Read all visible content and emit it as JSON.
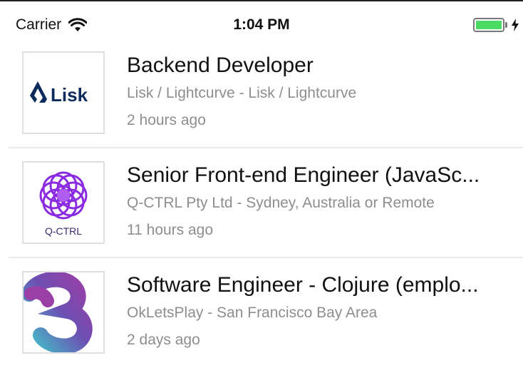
{
  "status_bar": {
    "carrier": "Carrier",
    "time": "1:04 PM",
    "battery_level": 1.0,
    "battery_color": "#4cd964"
  },
  "jobs": [
    {
      "title": "Backend Developer",
      "company": "Lisk / Lightcurve - Lisk / Lightcurve",
      "posted": "2 hours ago",
      "logo_text": "Lisk",
      "logo_icon": "lisk-logo-icon"
    },
    {
      "title": "Senior Front-end Engineer (JavaSc...",
      "company": "Q-CTRL Pty Ltd - Sydney, Australia or Remote",
      "posted": "11 hours ago",
      "logo_text": "Q-CTRL",
      "logo_icon": "qctrl-logo-icon"
    },
    {
      "title": "Software Engineer - Clojure (emplo...",
      "company": "OkLetsPlay - San Francisco Bay Area",
      "posted": "2 days ago",
      "logo_icon": "okletsplay-logo-icon"
    }
  ]
}
